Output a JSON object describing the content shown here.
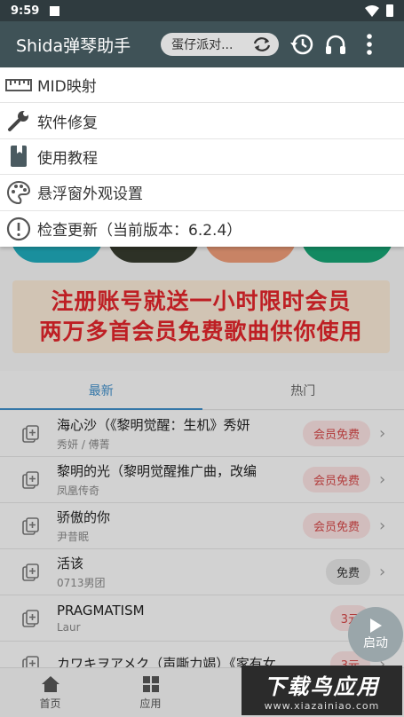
{
  "status": {
    "time": "9:59"
  },
  "appbar": {
    "title": "Shida弹琴助手",
    "current_song": "蛋仔派对..."
  },
  "menu": [
    {
      "label": "MID映射",
      "icon": "ruler-icon"
    },
    {
      "label": "软件修复",
      "icon": "wrench-icon"
    },
    {
      "label": "使用教程",
      "icon": "book-icon"
    },
    {
      "label": "悬浮窗外观设置",
      "icon": "palette-icon"
    },
    {
      "label": "检查更新（当前版本：6.2.4）",
      "icon": "info-icon"
    }
  ],
  "banner": {
    "line1": "注册账号就送一小时限时会员",
    "line2": "两万多首会员免费歌曲供你使用"
  },
  "tabs": [
    {
      "label": "最新"
    },
    {
      "label": "热门"
    }
  ],
  "songs": [
    {
      "name": "海心沙（《黎明觉醒：生机》秀妍",
      "artist": "秀妍 / 傅菁",
      "badge": "会员免费"
    },
    {
      "name": "黎明的光（黎明觉醒推广曲，改编",
      "artist": "凤凰传奇",
      "badge": "会员免费"
    },
    {
      "name": "骄傲的你",
      "artist": "尹昔眠",
      "badge": "会员免费"
    },
    {
      "name": "活该",
      "artist": "0713男团",
      "badge": "免费"
    },
    {
      "name": "PRAGMATISM",
      "artist": "Laur",
      "badge": "3元"
    },
    {
      "name": "カワキヲアメク（声嘶力竭）《家有女",
      "artist": "",
      "badge": "3元"
    }
  ],
  "bottomnav": [
    {
      "label": "首页"
    },
    {
      "label": "应用"
    }
  ],
  "floating": {
    "label": "启动"
  },
  "watermark": {
    "title": "下载鸟应用",
    "url": "www.xiazainiao.com"
  },
  "colors": {
    "appbar": "#3f5257",
    "accent": "#3f8cc6",
    "banner_text": "#e0252b"
  }
}
